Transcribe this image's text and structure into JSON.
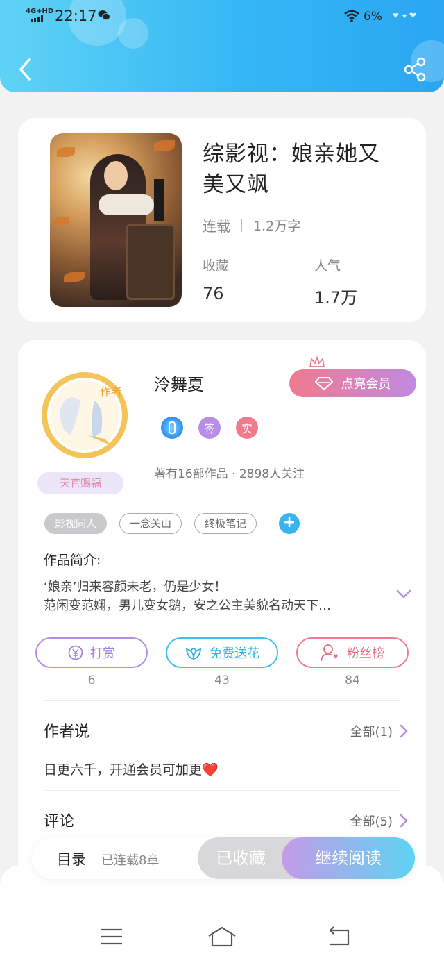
{
  "status_bar": {
    "network": "4G+HD",
    "time": "22:17",
    "battery": "6%"
  },
  "header": {
    "back_icon": "chevron-left-icon",
    "share_icon": "share-icon"
  },
  "book": {
    "title_line1": "综影视：娘亲她又",
    "title_line2": "美又飒",
    "status": "连载",
    "word_count": "1.2万字",
    "favorites_label": "收藏",
    "favorites_value": "76",
    "popularity_label": "人气",
    "popularity_value": "1.7万"
  },
  "author": {
    "name": "泠舞夏",
    "avatar_badge": "作者",
    "title_badge": "天官赐福",
    "vip_button": "点亮会员",
    "badges": [
      "",
      "签",
      "实"
    ],
    "stats": "著有16部作品 · 2898人关注"
  },
  "tags": [
    "影视同人",
    "一念关山",
    "终极笔记"
  ],
  "intro": {
    "title": "作品简介:",
    "line1": "‘娘亲’归来容颜未老，仍是少女！",
    "line2": "范闲变范娴，男儿变女鹅，安之公主美貌名动天下…"
  },
  "actions": {
    "tip_label": "打赏",
    "tip_count": "6",
    "flower_label": "免费送花",
    "flower_count": "43",
    "fans_label": "粉丝榜",
    "fans_count": "84"
  },
  "author_says": {
    "title": "作者说",
    "all": "全部(1)",
    "text": "日更六千，开通会员可加更❤️"
  },
  "comments": {
    "title": "评论",
    "all": "全部(5)"
  },
  "bottom_bar": {
    "toc": "目录",
    "chapters": "已连载8章",
    "favorited": "已收藏",
    "continue": "继续阅读"
  },
  "colors": {
    "header": "#35b6f4",
    "accent_purple": "#b58ee0",
    "accent_cyan": "#41c2e8",
    "accent_pink": "#f07a8e"
  }
}
